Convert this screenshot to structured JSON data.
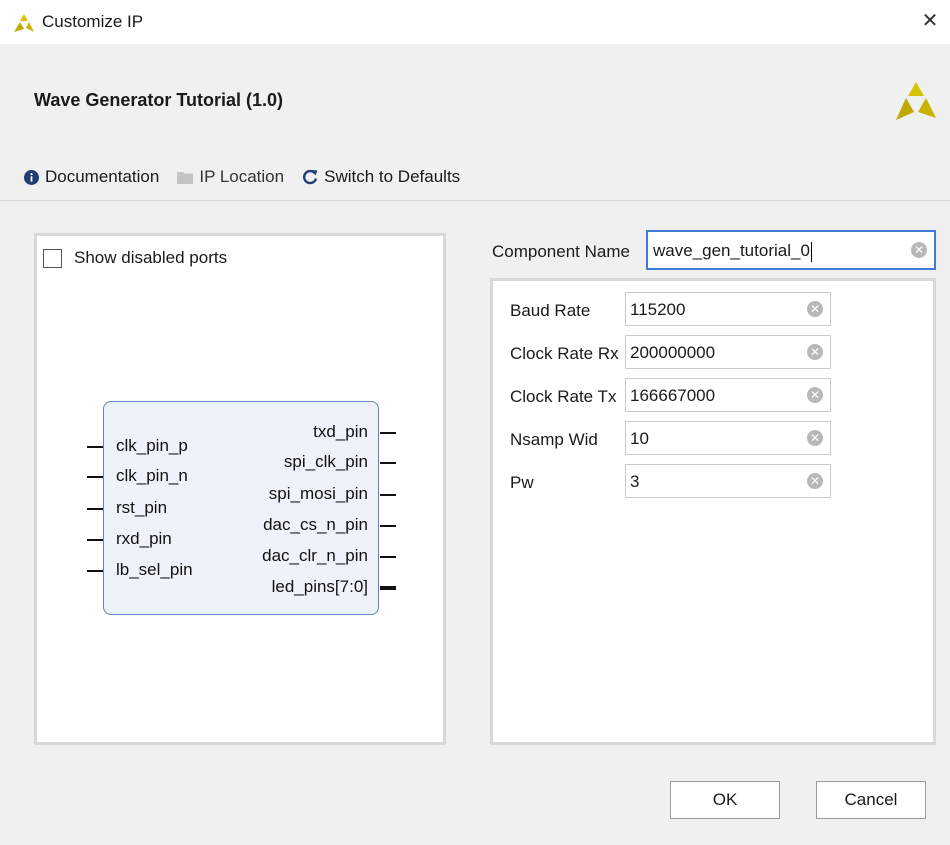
{
  "window": {
    "title": "Customize IP",
    "close_glyph": "✕"
  },
  "header": {
    "title": "Wave Generator Tutorial (1.0)"
  },
  "toolbar": {
    "documentation": "Documentation",
    "ip_location": "IP Location",
    "switch_defaults": "Switch to Defaults"
  },
  "left_panel": {
    "show_disabled_ports": "Show disabled ports",
    "show_disabled_checked": false,
    "input_pins": [
      "clk_pin_p",
      "clk_pin_n",
      "rst_pin",
      "rxd_pin",
      "lb_sel_pin"
    ],
    "output_pins": [
      "txd_pin",
      "spi_clk_pin",
      "spi_mosi_pin",
      "dac_cs_n_pin",
      "dac_clr_n_pin",
      "led_pins[7:0]"
    ]
  },
  "component": {
    "label": "Component Name",
    "value": "wave_gen_tutorial_0"
  },
  "params": [
    {
      "label": "Baud Rate",
      "value": "115200"
    },
    {
      "label": "Clock Rate Rx",
      "value": "200000000"
    },
    {
      "label": "Clock Rate Tx",
      "value": "166667000"
    },
    {
      "label": "Nsamp Wid",
      "value": "10"
    },
    {
      "label": "Pw",
      "value": "3"
    }
  ],
  "buttons": {
    "ok": "OK",
    "cancel": "Cancel"
  },
  "icons": {
    "app": "xilinx-logo-icon",
    "info": "info-icon",
    "folder": "folder-icon",
    "refresh": "refresh-icon",
    "clear": "clear-icon"
  },
  "colors": {
    "accent": "#3d7bd6",
    "logo": "#c8b400",
    "block_border": "#5f86c4"
  }
}
